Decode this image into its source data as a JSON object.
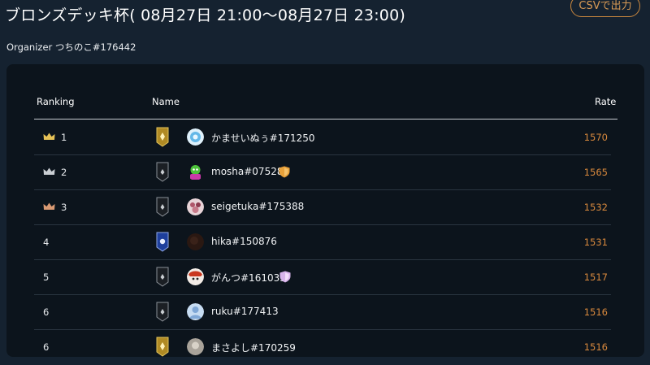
{
  "page": {
    "title": "ブロンズデッキ杯( 08月27日 21:00～08月27日 23:00)",
    "csv_button": "CSVで出力",
    "organizer": "Organizer つちのこ#176442"
  },
  "table": {
    "headers": {
      "ranking": "Ranking",
      "name": "Name",
      "rate": "Rate"
    },
    "rows": [
      {
        "rank": "1",
        "name": "かませいぬぅ#171250",
        "rate": "1570",
        "crown": "gold-crown-icon",
        "badge": "gold-rank-badge-icon",
        "avatar": "blue-swirl-avatar"
      },
      {
        "rank": "2",
        "name": "mosha#075280",
        "rate": "1565",
        "crown": "silver-crown-icon",
        "badge": "dark-rank-badge-icon",
        "avatar": "green-character-avatar",
        "shield": "orange-shield-icon"
      },
      {
        "rank": "3",
        "name": "seigetuka#175388",
        "rate": "1532",
        "crown": "bronze-crown-icon",
        "badge": "dark-rank-badge-icon",
        "avatar": "pink-character-avatar"
      },
      {
        "rank": "4",
        "name": "hika#150876",
        "rate": "1531",
        "badge": "blue-rank-badge-icon",
        "avatar": "dark-avatar"
      },
      {
        "rank": "5",
        "name": "がんつ#161033",
        "rate": "1517",
        "badge": "dark-rank-badge-icon",
        "avatar": "red-character-avatar",
        "shield": "pink-shield-icon"
      },
      {
        "rank": "6",
        "name": "ruku#177413",
        "rate": "1516",
        "badge": "dark-rank-badge-icon",
        "avatar": "default-user-avatar"
      },
      {
        "rank": "6",
        "name": "まさよし#170259",
        "rate": "1516",
        "badge": "gold-rank-badge-icon",
        "avatar": "gray-avatar"
      }
    ]
  }
}
